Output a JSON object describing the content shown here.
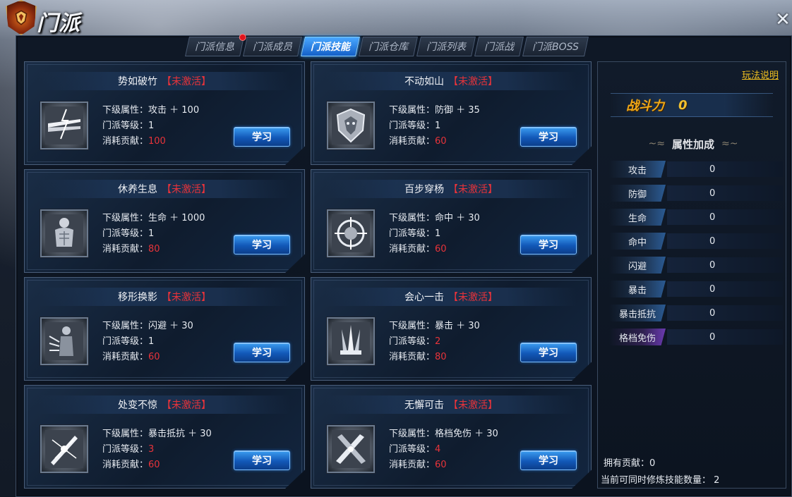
{
  "header": {
    "title": "门派",
    "close_glyph": "✕"
  },
  "tabs": [
    {
      "label": "门派信息",
      "active": false,
      "badge": true
    },
    {
      "label": "门派成员",
      "active": false,
      "badge": false
    },
    {
      "label": "门派技能",
      "active": true,
      "badge": false
    },
    {
      "label": "门派仓库",
      "active": false,
      "badge": false
    },
    {
      "label": "门派列表",
      "active": false,
      "badge": false
    },
    {
      "label": "门派战",
      "active": false,
      "badge": false
    },
    {
      "label": "门派BOSS",
      "active": false,
      "badge": false
    }
  ],
  "skills": [
    {
      "name": "势如破竹",
      "status": "【未激活】",
      "attr_label": "下级属性：",
      "attr": "攻击 ＋ 100",
      "level_label": "门派等级：",
      "level": "1",
      "cost_label": "消耗贡献：",
      "cost": "100",
      "button": "学习",
      "icon": "lightning-blades-icon"
    },
    {
      "name": "不动如山",
      "status": "【未激活】",
      "attr_label": "下级属性：",
      "attr": "防御 ＋ 35",
      "level_label": "门派等级：",
      "level": "1",
      "cost_label": "消耗贡献：",
      "cost": "60",
      "button": "学习",
      "icon": "shield-icon"
    },
    {
      "name": "休养生息",
      "status": "【未激活】",
      "attr_label": "下级属性：",
      "attr": "生命 ＋ 1000",
      "level_label": "门派等级：",
      "level": "1",
      "cost_label": "消耗贡献：",
      "cost": "80",
      "button": "学习",
      "icon": "body-icon"
    },
    {
      "name": "百步穿杨",
      "status": "【未激活】",
      "attr_label": "下级属性：",
      "attr": "命中 ＋ 30",
      "level_label": "门派等级：",
      "level": "1",
      "cost_label": "消耗贡献：",
      "cost": "60",
      "button": "学习",
      "icon": "crosshair-icon"
    },
    {
      "name": "移形换影",
      "status": "【未激活】",
      "attr_label": "下级属性：",
      "attr": "闪避 ＋ 30",
      "level_label": "门派等级：",
      "level": "1",
      "cost_label": "消耗贡献：",
      "cost": "60",
      "button": "学习",
      "icon": "shadow-figure-icon"
    },
    {
      "name": "会心一击",
      "status": "【未激活】",
      "attr_label": "下级属性：",
      "attr": "暴击 ＋ 30",
      "level_label": "门派等级：",
      "level": "2",
      "cost_label": "消耗贡献：",
      "cost": "80",
      "button": "学习",
      "icon": "triple-blade-icon"
    },
    {
      "name": "处变不惊",
      "status": "【未激活】",
      "attr_label": "下级属性：",
      "attr": "暴击抵抗 ＋ 30",
      "level_label": "门派等级：",
      "level": "3",
      "cost_label": "消耗贡献：",
      "cost": "60",
      "button": "学习",
      "icon": "sword-burst-icon"
    },
    {
      "name": "无懈可击",
      "status": "【未激活】",
      "attr_label": "下级属性：",
      "attr": "格档免伤 ＋ 30",
      "level_label": "门派等级：",
      "level": "4",
      "cost_label": "消耗贡献：",
      "cost": "60",
      "button": "学习",
      "icon": "crossed-swords-icon"
    }
  ],
  "side": {
    "help_link": "玩法说明",
    "power_label": "战斗力",
    "power_value": "0",
    "attr_header": "属性加成",
    "stats": [
      {
        "label": "攻击",
        "value": "0"
      },
      {
        "label": "防御",
        "value": "0"
      },
      {
        "label": "生命",
        "value": "0"
      },
      {
        "label": "命中",
        "value": "0"
      },
      {
        "label": "闪避",
        "value": "0"
      },
      {
        "label": "暴击",
        "value": "0"
      },
      {
        "label": "暴击抵抗",
        "value": "0"
      },
      {
        "label": "格档免伤",
        "value": "0"
      }
    ],
    "own_label": "拥有贡献：",
    "own_value": "0",
    "concurrent_label": "当前可同时修炼技能数量：",
    "concurrent_value": "2"
  },
  "colors": {
    "accent": "#2a7ad8",
    "warning": "#e8333a",
    "gold": "#f0a818"
  }
}
